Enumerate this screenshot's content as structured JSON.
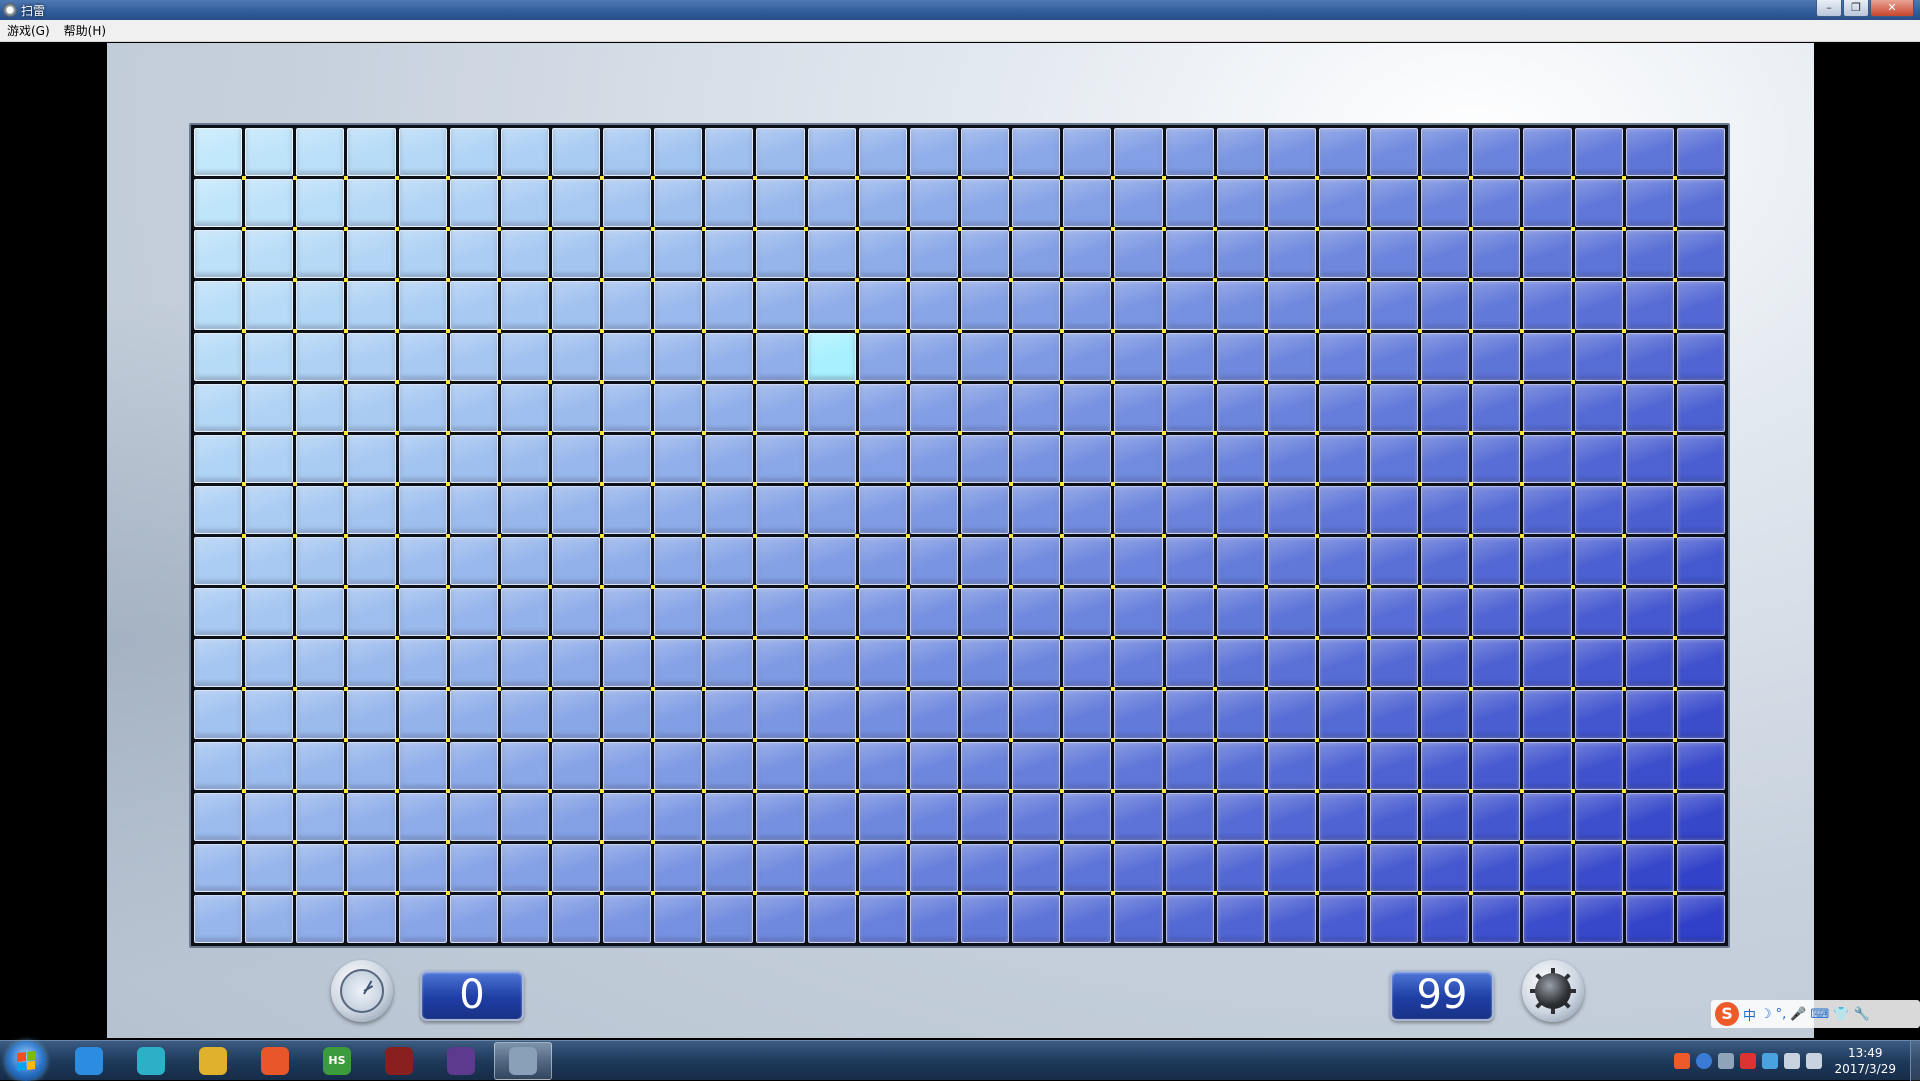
{
  "window": {
    "title": "扫雷",
    "minimize": "–",
    "maximize": "❐",
    "close": "✕"
  },
  "menu": {
    "items": [
      "游戏(G)",
      "帮助(H)"
    ]
  },
  "board": {
    "columns": 30,
    "rows": 16,
    "hovered_cell": {
      "row": 4,
      "col": 12
    },
    "colors": {
      "top_left": "#c2e8fb",
      "bottom_right": "#3040c8",
      "hover": "#a8f0ff",
      "grid_dot": "#ffe83a"
    }
  },
  "counters": {
    "time": "0",
    "mines": "99"
  },
  "ime": {
    "logo": "S",
    "items": [
      "中",
      "☽",
      "°,",
      "🎤",
      "⌨",
      "👕",
      "🔧"
    ]
  },
  "taskbar": {
    "apps": [
      {
        "name": "qq-icon",
        "label": "",
        "color": "#2c8de0"
      },
      {
        "name": "bird-app-icon",
        "label": "",
        "color": "#2bb0c8"
      },
      {
        "name": "chrome-icon",
        "label": "",
        "color": "#e0b12c"
      },
      {
        "name": "rocket-app-icon",
        "label": "",
        "color": "#e8572a"
      },
      {
        "name": "hs-app-icon",
        "label": "HS",
        "color": "#3c9b3a"
      },
      {
        "name": "game-app-icon",
        "label": "",
        "color": "#8a1f1f"
      },
      {
        "name": "java-ee-icon",
        "label": "",
        "color": "#5e3a8e"
      },
      {
        "name": "minesweeper-app-icon",
        "label": "",
        "color": "#8aa0b8"
      }
    ],
    "active_app": 7,
    "time": "13:49",
    "date": "2017/3/29"
  }
}
